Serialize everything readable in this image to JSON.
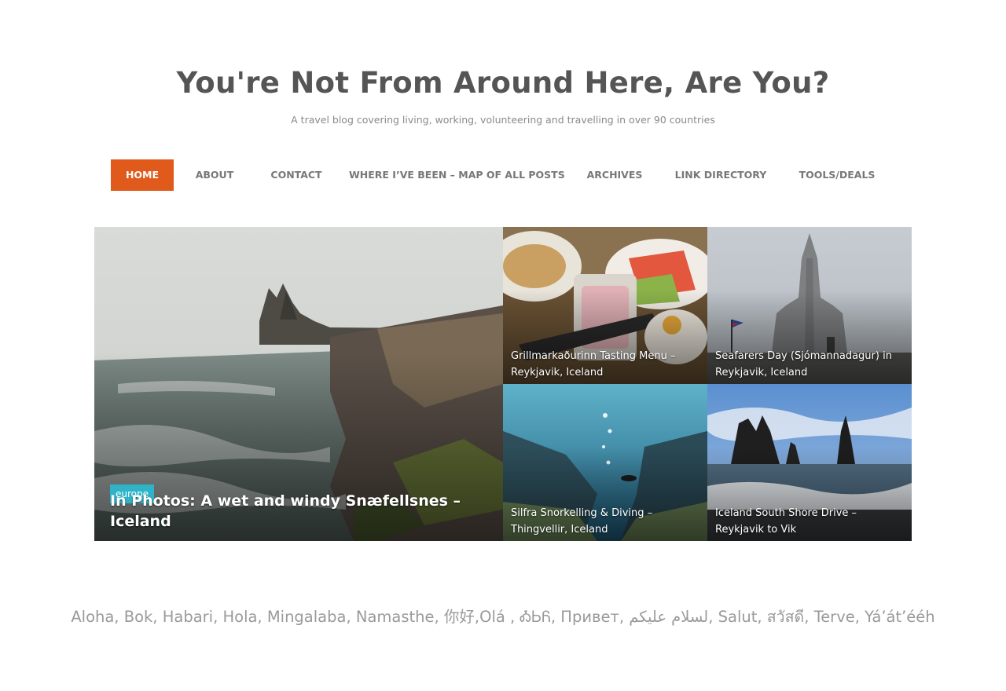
{
  "site": {
    "title": "You're Not From Around Here, Are You?",
    "tagline": "A travel blog covering living, working, volunteering and travelling in over 90 countries"
  },
  "nav": {
    "items": [
      {
        "label": "HOME",
        "active": true
      },
      {
        "label": "ABOUT"
      },
      {
        "label": "CONTACT"
      },
      {
        "label": "WHERE I’VE BEEN – MAP OF ALL POSTS"
      },
      {
        "label": "ARCHIVES"
      },
      {
        "label": "LINK DIRECTORY"
      },
      {
        "label": "TOOLS/DEALS"
      }
    ],
    "active_color": "#e05a1b"
  },
  "featured": {
    "main": {
      "category": "europe",
      "title": "In Photos: A wet and windy Snæfellsnes – Iceland"
    },
    "posts": [
      {
        "title": "Grillmarkaðurinn Tasting Menu – Reykjavik, Iceland"
      },
      {
        "title": "Seafarers Day (Sjómannadagur) in Reykjavik, Iceland"
      },
      {
        "title": "Silfra Snorkelling & Diving – Thingvellir, Iceland"
      },
      {
        "title": "Iceland South Shore Drive – Reykjavik to Vik"
      }
    ],
    "category_color": "#2fb3c9"
  },
  "greeting": "Aloha, Bok, Habari, Hola, Mingalaba, Namasthe, 你好,Olá , ᎣᏏᏲ, Привет, لسلام عليكم, Salut, สวัสดี, Terve, Yá’át’ééh"
}
